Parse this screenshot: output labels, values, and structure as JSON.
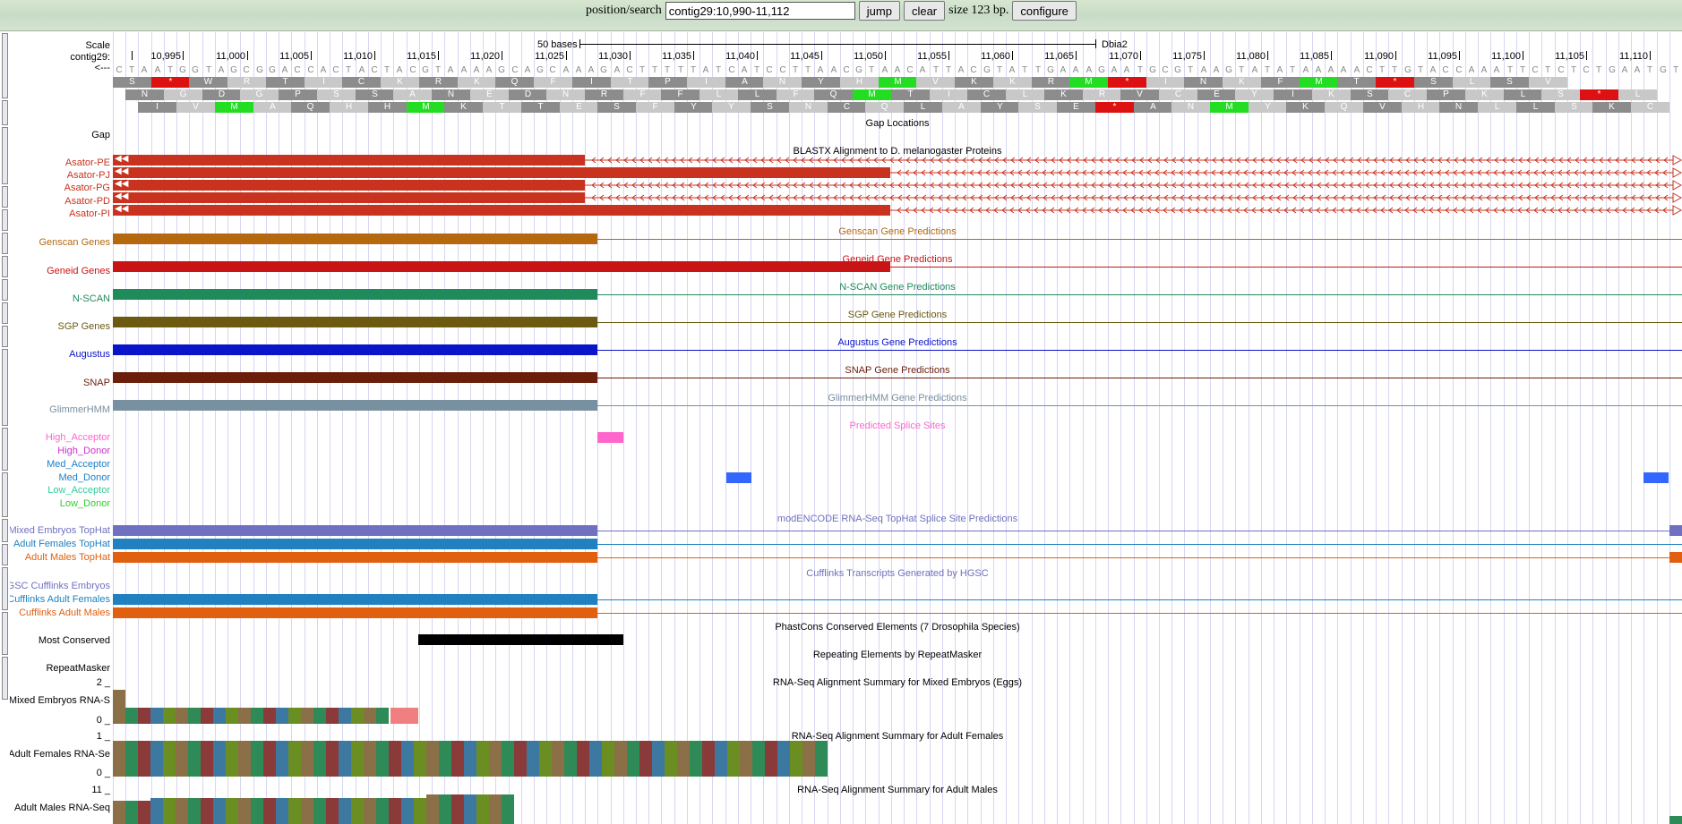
{
  "toolbar": {
    "position_label": "position/search",
    "position_value": "contig29:10,990-11,112",
    "jump_label": "jump",
    "clear_label": "clear",
    "size_text": "size 123 bp.",
    "configure_label": "configure"
  },
  "ruler": {
    "scale_label": "Scale",
    "contig_label": "contig29:",
    "strand_label": "<---",
    "scale_bar_text": "50 bases",
    "assembly_label": "Dbia2",
    "positions": [
      "10,995",
      "11,000",
      "11,005",
      "11,010",
      "11,015",
      "11,020",
      "11,025",
      "11,030",
      "11,035",
      "11,040",
      "11,045",
      "11,050",
      "11,055",
      "11,060",
      "11,065",
      "11,070",
      "11,075",
      "11,080",
      "11,085",
      "11,090",
      "11,095",
      "11,100",
      "11,105",
      "11,110"
    ]
  },
  "sequence": "CTAATGGTAGCGGACCACTACTACGTAAAAGCAGCAAAGACTTTTTATCATCCTTAACGTAACATTACGTATTGAAAGAATGCGTAAGTATATAAAAACTTGTACCAAATTCTCTCTGAATGT",
  "frames": [
    [
      "S",
      "*",
      "W",
      "R",
      "T",
      "I",
      "C",
      "K",
      "R",
      "K",
      "Q",
      "F",
      "I",
      "T",
      "P",
      "I",
      "A",
      "N",
      "Y",
      "H",
      "M",
      "V",
      "K",
      "K",
      "R",
      "M",
      "*",
      "I",
      "N",
      "K",
      "F",
      "M",
      "T",
      "*",
      "S",
      "L",
      "S",
      "V"
    ],
    [
      "N",
      "G",
      "D",
      "G",
      "P",
      "S",
      "S",
      "A",
      "N",
      "E",
      "D",
      "N",
      "R",
      "F",
      "F",
      "L",
      "L",
      "F",
      "Q",
      "M",
      "T",
      "I",
      "C",
      "L",
      "K",
      "R",
      "V",
      "C",
      "E",
      "Y",
      "I",
      "K",
      "S",
      "C",
      "P",
      "K",
      "L",
      "S",
      "*",
      "L"
    ],
    [
      "I",
      "V",
      "M",
      "A",
      "Q",
      "H",
      "H",
      "M",
      "K",
      "T",
      "T",
      "E",
      "S",
      "F",
      "Y",
      "Y",
      "S",
      "N",
      "C",
      "Q",
      "L",
      "A",
      "Y",
      "S",
      "E",
      "*",
      "A",
      "N",
      "M",
      "Y",
      "K",
      "Q",
      "V",
      "H",
      "N",
      "L",
      "L",
      "S",
      "K",
      "C"
    ]
  ],
  "tracks": {
    "gap_label": "Gap",
    "gap_title": "Gap Locations",
    "blastx_title": "BLASTX Alignment to D. melanogaster Proteins",
    "blastx_items": [
      "Asator-PE",
      "Asator-PJ",
      "Asator-PG",
      "Asator-PD",
      "Asator-PI"
    ],
    "genscan_label": "Genscan Genes",
    "genscan_title": "Genscan Gene Predictions",
    "geneid_label": "Geneid Genes",
    "geneid_title": "Geneid Gene Predictions",
    "nscan_label": "N-SCAN",
    "nscan_title": "N-SCAN Gene Predictions",
    "sgp_label": "SGP Genes",
    "sgp_title": "SGP Gene Predictions",
    "augustus_label": "Augustus",
    "augustus_title": "Augustus Gene Predictions",
    "snap_label": "SNAP",
    "snap_title": "SNAP Gene Predictions",
    "glimmer_label": "GlimmerHMM",
    "glimmer_title": "GlimmerHMM Gene Predictions",
    "splice_title": "Predicted Splice Sites",
    "splice_items": [
      "High_Acceptor",
      "High_Donor",
      "Med_Acceptor",
      "Med_Donor",
      "Low_Acceptor",
      "Low_Donor"
    ],
    "tophat_title": "modENCODE RNA-Seq TopHat Splice Site Predictions",
    "tophat_items": [
      "Mixed Embryos TopHat",
      "Adult Females TopHat",
      "Adult Males TopHat"
    ],
    "cufflinks_title": "Cufflinks Transcripts Generated by HGSC",
    "cufflinks_items": [
      "HGSC Cufflinks Embryos",
      "Cufflinks Adult Females",
      "Cufflinks Adult Males"
    ],
    "phastcons_title": "PhastCons Conserved Elements (7 Drosophila Species)",
    "phastcons_label": "Most Conserved",
    "repeat_title": "Repeating Elements by RepeatMasker",
    "repeat_label": "RepeatMasker",
    "rnaseq_embryo_title": "RNA-Seq Alignment Summary for Mixed Embryos (Eggs)",
    "rnaseq_embryo_label": "Mixed Embryos RNA-S",
    "rnaseq_embryo_max": "2 _",
    "rnaseq_embryo_min": "0 _",
    "rnaseq_female_title": "RNA-Seq Alignment Summary for Adult Females",
    "rnaseq_female_label": "Adult Females RNA-Se",
    "rnaseq_female_max": "1 _",
    "rnaseq_female_min": "0 _",
    "rnaseq_male_title": "RNA-Seq Alignment Summary for Adult Males",
    "rnaseq_male_label": "Adult Males RNA-Seq",
    "rnaseq_male_max": "11 _"
  },
  "colors": {
    "blastx": "#c8321e",
    "genscan": "#b5680e",
    "geneid": "#c81414",
    "nscan": "#1f8a5a",
    "sgp": "#6b5a10",
    "augustus": "#0a14c8",
    "snap": "#6b1e0a",
    "glimmer": "#7890a0",
    "high_acceptor": "#ff66cc",
    "med_donor": "#3366ff",
    "tophat_embryo": "#7070c0",
    "tophat_female": "#2080c0",
    "tophat_male": "#e06010",
    "cuff_embryo": "#7070c0",
    "cuff_female": "#2080c0",
    "cuff_male": "#e06010"
  }
}
